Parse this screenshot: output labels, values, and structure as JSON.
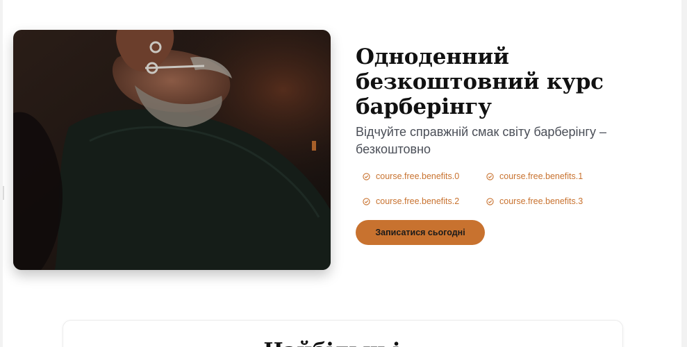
{
  "hero": {
    "image_alt": "barber-trimming-client-beard-photo",
    "title": "Одноденний безкоштовний курс барберінгу",
    "subtitle": "Відчуйте справжній смак світу барберінгу – безкоштовно",
    "benefits": [
      "course.free.benefits.0",
      "course.free.benefits.1",
      "course.free.benefits.2",
      "course.free.benefits.3"
    ],
    "cta_label": "Записатися сьогодні"
  },
  "next_section": {
    "title": "Найбільш і..."
  },
  "colors": {
    "accent": "#c8722f",
    "title": "#111111",
    "subtitle": "#4a4e57",
    "background": "#ffffff"
  }
}
